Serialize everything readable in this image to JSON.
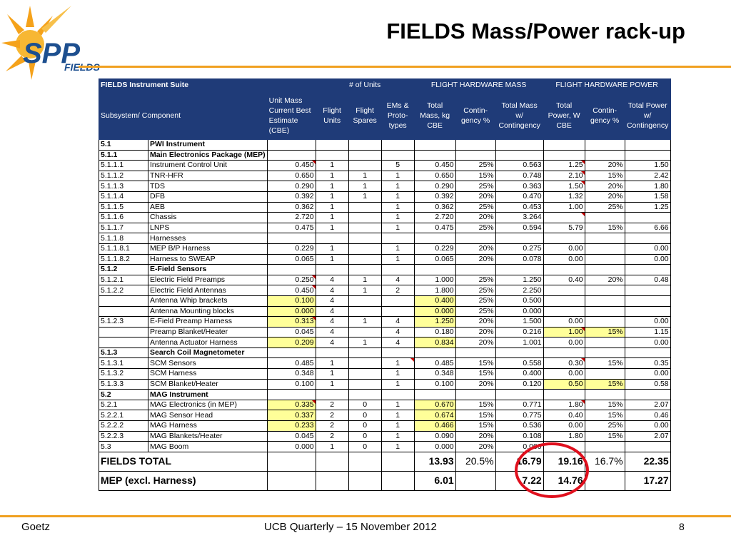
{
  "slide": {
    "title": "FIELDS Mass/Power rack-up",
    "logo": {
      "text_main": "SPP",
      "text_sub": "FIELDS",
      "icon": "sun-logo-icon"
    },
    "footer": {
      "author": "Goetz",
      "event": "UCB Quarterly – 15 November 2012",
      "page": "8"
    },
    "accent_color": "#f0a020",
    "header_color": "#1f3b78",
    "highlight_color": "#ffff99",
    "annotation_color": "#e0101e"
  },
  "table": {
    "band": {
      "suite": "FIELDS Instrument Suite",
      "units": "# of Units",
      "mass": "FLIGHT HARDWARE MASS",
      "power": "FLIGHT HARDWARE POWER"
    },
    "columns": {
      "subsystem": "Subsystem/ Component",
      "unit_mass": "Unit Mass Current Best Estimate (CBE)",
      "flight_units": "Flight Units",
      "flight_spares": "Flight Spares",
      "ems": "EMs & Proto- types",
      "total_mass": "Total Mass, kg CBE",
      "mass_cont": "Contin- gency %",
      "total_mass_cont": "Total Mass w/ Contingency",
      "total_power": "Total Power, W CBE",
      "power_cont": "Contin- gency %",
      "total_power_cont": "Total Power w/ Contingency"
    },
    "rows": [
      {
        "id": "5.1",
        "name": "PWI Instrument",
        "um": "",
        "fu": "",
        "fs": "",
        "em": "",
        "tm": "",
        "mc": "",
        "tmc": "",
        "tp": "",
        "pc": "",
        "tpc": ""
      },
      {
        "id": "5.1.1",
        "name": "Main Electronics Package (MEP)",
        "um": "",
        "fu": "",
        "fs": "",
        "em": "",
        "tm": "",
        "mc": "",
        "tmc": "",
        "tp": "",
        "pc": "",
        "tpc": ""
      },
      {
        "id": "5.1.1.1",
        "name": "Instrument Control Unit",
        "um": "0.450",
        "fu": "1",
        "fs": "",
        "em": "5",
        "tm": "0.450",
        "mc": "25%",
        "tmc": "0.563",
        "tp": "1.25",
        "pc": "20%",
        "tpc": "1.50"
      },
      {
        "id": "5.1.1.2",
        "name": "TNR-HFR",
        "um": "0.650",
        "fu": "1",
        "fs": "1",
        "em": "1",
        "tm": "0.650",
        "mc": "15%",
        "tmc": "0.748",
        "tp": "2.10",
        "pc": "15%",
        "tpc": "2.42"
      },
      {
        "id": "5.1.1.3",
        "name": "TDS",
        "um": "0.290",
        "fu": "1",
        "fs": "1",
        "em": "1",
        "tm": "0.290",
        "mc": "25%",
        "tmc": "0.363",
        "tp": "1.50",
        "pc": "20%",
        "tpc": "1.80"
      },
      {
        "id": "5.1.1.4",
        "name": "DFB",
        "um": "0.392",
        "fu": "1",
        "fs": "1",
        "em": "1",
        "tm": "0.392",
        "mc": "20%",
        "tmc": "0.470",
        "tp": "1.32",
        "pc": "20%",
        "tpc": "1.58"
      },
      {
        "id": "5.1.1.5",
        "name": "AEB",
        "um": "0.362",
        "fu": "1",
        "fs": "",
        "em": "1",
        "tm": "0.362",
        "mc": "25%",
        "tmc": "0.453",
        "tp": "1.00",
        "pc": "25%",
        "tpc": "1.25"
      },
      {
        "id": "5.1.1.6",
        "name": "Chassis",
        "um": "2.720",
        "fu": "1",
        "fs": "",
        "em": "1",
        "tm": "2.720",
        "mc": "20%",
        "tmc": "3.264",
        "tp": "",
        "pc": "",
        "tpc": ""
      },
      {
        "id": "5.1.1.7",
        "name": "LNPS",
        "um": "0.475",
        "fu": "1",
        "fs": "",
        "em": "1",
        "tm": "0.475",
        "mc": "25%",
        "tmc": "0.594",
        "tp": "5.79",
        "pc": "15%",
        "tpc": "6.66"
      },
      {
        "id": "5.1.1.8",
        "name": "Harnesses",
        "um": "",
        "fu": "",
        "fs": "",
        "em": "",
        "tm": "",
        "mc": "",
        "tmc": "",
        "tp": "",
        "pc": "",
        "tpc": ""
      },
      {
        "id": "5.1.1.8.1",
        "name": "MEP B/P Harness",
        "um": "0.229",
        "fu": "1",
        "fs": "",
        "em": "1",
        "tm": "0.229",
        "mc": "20%",
        "tmc": "0.275",
        "tp": "0.00",
        "pc": "",
        "tpc": "0.00"
      },
      {
        "id": "5.1.1.8.2",
        "name": "Harness to SWEAP",
        "um": "0.065",
        "fu": "1",
        "fs": "",
        "em": "1",
        "tm": "0.065",
        "mc": "20%",
        "tmc": "0.078",
        "tp": "0.00",
        "pc": "",
        "tpc": "0.00"
      },
      {
        "id": "5.1.2",
        "name": "E-Field Sensors",
        "um": "",
        "fu": "",
        "fs": "",
        "em": "",
        "tm": "",
        "mc": "",
        "tmc": "",
        "tp": "",
        "pc": "",
        "tpc": ""
      },
      {
        "id": "5.1.2.1",
        "name": "Electric Field Preamps",
        "um": "0.250",
        "fu": "4",
        "fs": "1",
        "em": "4",
        "tm": "1.000",
        "mc": "25%",
        "tmc": "1.250",
        "tp": "0.40",
        "pc": "20%",
        "tpc": "0.48"
      },
      {
        "id": "5.1.2.2",
        "name": "Electric Field Antennas",
        "um": "0.450",
        "fu": "4",
        "fs": "1",
        "em": "2",
        "tm": "1.800",
        "mc": "25%",
        "tmc": "2.250",
        "tp": "",
        "pc": "",
        "tpc": ""
      },
      {
        "id": "",
        "name": "Antenna Whip brackets",
        "um": "0.100",
        "fu": "4",
        "fs": "",
        "em": "",
        "tm": "0.400",
        "mc": "25%",
        "tmc": "0.500",
        "tp": "",
        "pc": "",
        "tpc": ""
      },
      {
        "id": "",
        "name": "Antenna Mounting blocks",
        "um": "0.000",
        "fu": "4",
        "fs": "",
        "em": "",
        "tm": "0.000",
        "mc": "25%",
        "tmc": "0.000",
        "tp": "",
        "pc": "",
        "tpc": ""
      },
      {
        "id": "5.1.2.3",
        "name": "E-Field Preamp Harness",
        "um": "0.313",
        "fu": "4",
        "fs": "1",
        "em": "4",
        "tm": "1.250",
        "mc": "20%",
        "tmc": "1.500",
        "tp": "0.00",
        "pc": "",
        "tpc": "0.00"
      },
      {
        "id": "",
        "name": "Preamp Blanket/Heater",
        "um": "0.045",
        "fu": "4",
        "fs": "",
        "em": "4",
        "tm": "0.180",
        "mc": "20%",
        "tmc": "0.216",
        "tp": "1.00",
        "pc": "15%",
        "tpc": "1.15"
      },
      {
        "id": "",
        "name": "Antenna Actuator Harness",
        "um": "0.209",
        "fu": "4",
        "fs": "1",
        "em": "4",
        "tm": "0.834",
        "mc": "20%",
        "tmc": "1.001",
        "tp": "0.00",
        "pc": "",
        "tpc": "0.00"
      },
      {
        "id": "5.1.3",
        "name": "Search Coil Magnetometer",
        "um": "",
        "fu": "",
        "fs": "",
        "em": "",
        "tm": "",
        "mc": "",
        "tmc": "",
        "tp": "",
        "pc": "",
        "tpc": ""
      },
      {
        "id": "5.1.3.1",
        "name": "SCM Sensors",
        "um": "0.485",
        "fu": "1",
        "fs": "",
        "em": "1",
        "tm": "0.485",
        "mc": "15%",
        "tmc": "0.558",
        "tp": "0.30",
        "pc": "15%",
        "tpc": "0.35"
      },
      {
        "id": "5.1.3.2",
        "name": "SCM Harness",
        "um": "0.348",
        "fu": "1",
        "fs": "",
        "em": "1",
        "tm": "0.348",
        "mc": "15%",
        "tmc": "0.400",
        "tp": "0.00",
        "pc": "",
        "tpc": "0.00"
      },
      {
        "id": "5.1.3.3",
        "name": "SCM Blanket/Heater",
        "um": "0.100",
        "fu": "1",
        "fs": "",
        "em": "1",
        "tm": "0.100",
        "mc": "20%",
        "tmc": "0.120",
        "tp": "0.50",
        "pc": "15%",
        "tpc": "0.58"
      },
      {
        "id": "5.2",
        "name": "MAG Instrument",
        "um": "",
        "fu": "",
        "fs": "",
        "em": "",
        "tm": "",
        "mc": "",
        "tmc": "",
        "tp": "",
        "pc": "",
        "tpc": ""
      },
      {
        "id": "5.2.1",
        "name": "MAG Electronics (in MEP)",
        "um": "0.335",
        "fu": "2",
        "fs": "0",
        "em": "1",
        "tm": "0.670",
        "mc": "15%",
        "tmc": "0.771",
        "tp": "1.80",
        "pc": "15%",
        "tpc": "2.07"
      },
      {
        "id": "5.2.2.1",
        "name": "MAG Sensor Head",
        "um": "0.337",
        "fu": "2",
        "fs": "0",
        "em": "1",
        "tm": "0.674",
        "mc": "15%",
        "tmc": "0.775",
        "tp": "0.40",
        "pc": "15%",
        "tpc": "0.46"
      },
      {
        "id": "5.2.2.2",
        "name": "MAG Harness",
        "um": "0.233",
        "fu": "2",
        "fs": "0",
        "em": "1",
        "tm": "0.466",
        "mc": "15%",
        "tmc": "0.536",
        "tp": "0.00",
        "pc": "25%",
        "tpc": "0.00"
      },
      {
        "id": "5.2.2.3",
        "name": "MAG Blankets/Heater",
        "um": "0.045",
        "fu": "2",
        "fs": "0",
        "em": "1",
        "tm": "0.090",
        "mc": "20%",
        "tmc": "0.108",
        "tp": "1.80",
        "pc": "15%",
        "tpc": "2.07"
      },
      {
        "id": "5.3",
        "name": "MAG Boom",
        "um": "0.000",
        "fu": "1",
        "fs": "0",
        "em": "1",
        "tm": "0.000",
        "mc": "20%",
        "tmc": "0.000",
        "tp": "",
        "pc": "",
        "tpc": ""
      }
    ],
    "totals": [
      {
        "label": "FIELDS TOTAL",
        "tm": "13.93",
        "mc": "20.5%",
        "tmc": "16.79",
        "tp": "19.16",
        "pc": "16.7%",
        "tpc": "22.35"
      },
      {
        "label": "MEP (excl. Harness)",
        "tm": "6.01",
        "mc": "",
        "tmc": "7.22",
        "tp": "14.76",
        "pc": "",
        "tpc": "17.27"
      }
    ]
  }
}
